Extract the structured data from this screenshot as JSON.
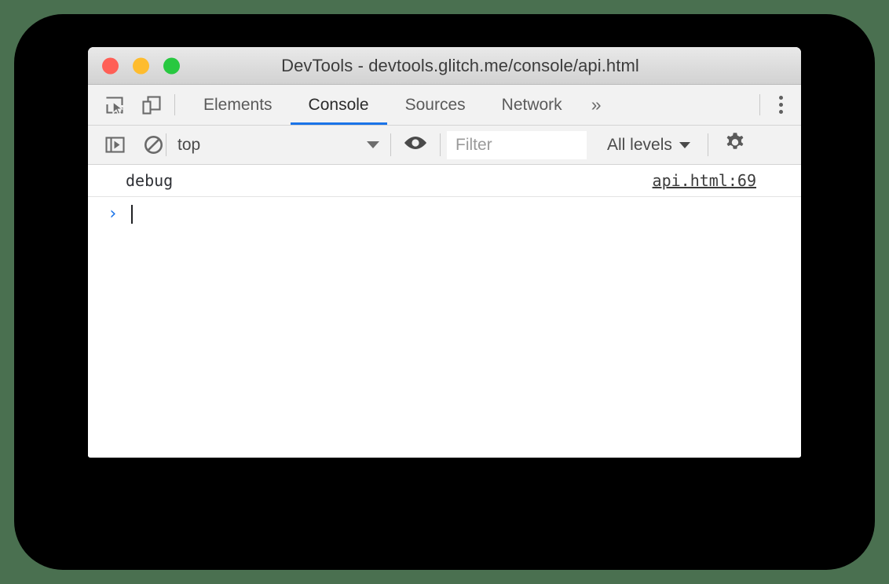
{
  "window": {
    "title": "DevTools - devtools.glitch.me/console/api.html",
    "traffic_lights": [
      {
        "name": "close",
        "color": "#ff5f56"
      },
      {
        "name": "minimize",
        "color": "#febc2e"
      },
      {
        "name": "zoom",
        "color": "#28c840"
      }
    ]
  },
  "tabbar": {
    "icons": [
      {
        "name": "inspect-element-icon"
      },
      {
        "name": "device-toolbar-icon"
      }
    ],
    "tabs": [
      {
        "label": "Elements",
        "active": false
      },
      {
        "label": "Console",
        "active": true
      },
      {
        "label": "Sources",
        "active": false
      },
      {
        "label": "Network",
        "active": false
      }
    ],
    "more_tabs_label": "»",
    "menu_icon": "more-vertical-icon",
    "active_tab_color": "#1a73e8"
  },
  "console_toolbar": {
    "sidebar_toggle_icon": "show-console-sidebar-icon",
    "clear_icon": "clear-console-icon",
    "context_selector": {
      "value": "top",
      "caret": "▼"
    },
    "live_expression_icon": "eye-icon",
    "filter": {
      "value": "",
      "placeholder": "Filter"
    },
    "log_levels": {
      "label": "All levels",
      "caret": "▼"
    },
    "settings_icon": "gear-icon"
  },
  "console": {
    "messages": [
      {
        "text": "debug",
        "source": "api.html:69"
      }
    ],
    "prompt": {
      "arrow": "›",
      "input_value": ""
    }
  },
  "colors": {
    "page_background": "#4a7050",
    "backdrop": "#000000",
    "window_background": "#ffffff",
    "toolbar_background": "#f2f2f2",
    "accent": "#1a73e8"
  }
}
